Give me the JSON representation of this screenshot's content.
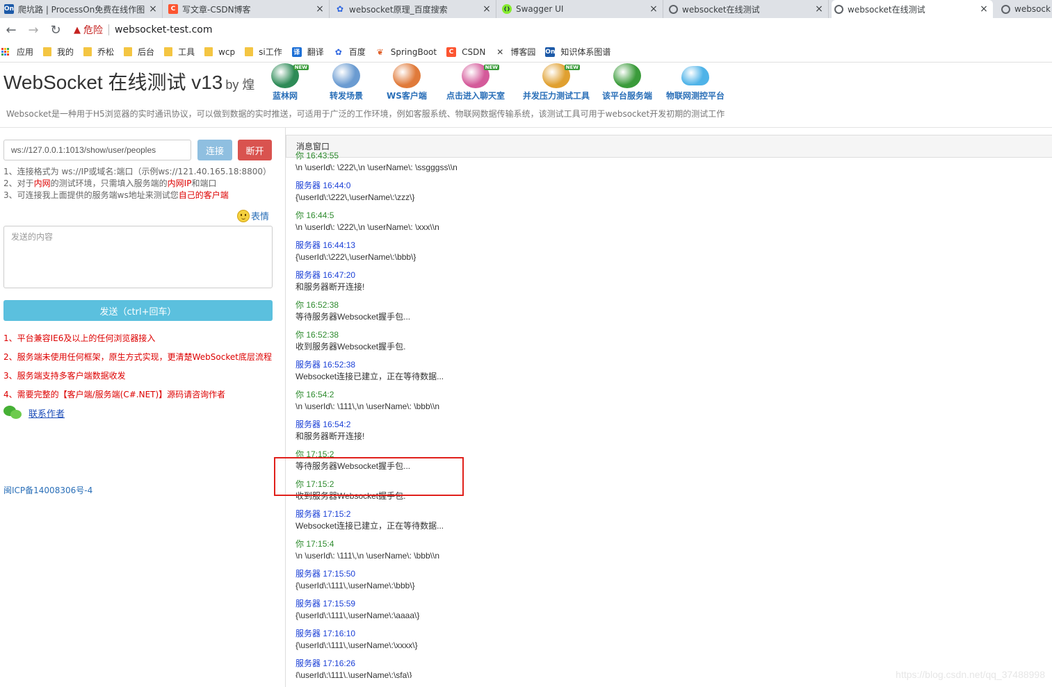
{
  "browser": {
    "tabs": [
      {
        "title": "爬坑路 | ProcessOn免费在线作图",
        "favicon": "On",
        "color": "#1d5aa8"
      },
      {
        "title": "写文章-CSDN博客",
        "favicon": "C",
        "color": "#fc5531"
      },
      {
        "title": "websocket原理_百度搜索",
        "favicon": "paw",
        "color": "#2d65e0"
      },
      {
        "title": "Swagger UI",
        "favicon": "S",
        "color": "#85ea2d"
      },
      {
        "title": "websocket在线测试",
        "favicon": "globe",
        "color": "#5f6368"
      },
      {
        "title": "websocket在线测试",
        "favicon": "globe",
        "color": "#5f6368"
      },
      {
        "title": "websock",
        "favicon": "globe",
        "color": "#5f6368"
      }
    ],
    "address": {
      "security": "危险",
      "url": "websocket-test.com"
    },
    "bookmarks": [
      {
        "label": "应用",
        "icon": "apps"
      },
      {
        "label": "我的",
        "icon": "folder"
      },
      {
        "label": "乔松",
        "icon": "folder"
      },
      {
        "label": "后台",
        "icon": "folder"
      },
      {
        "label": "工具",
        "icon": "folder"
      },
      {
        "label": "wcp",
        "icon": "folder"
      },
      {
        "label": "si工作",
        "icon": "folder"
      },
      {
        "label": "翻译",
        "icon": "translate"
      },
      {
        "label": "百度",
        "icon": "baidu"
      },
      {
        "label": "SpringBoot",
        "icon": "spring"
      },
      {
        "label": "CSDN",
        "icon": "csdn"
      },
      {
        "label": "博客园",
        "icon": "cnblogs"
      },
      {
        "label": "知识体系图谱",
        "icon": "processon"
      }
    ]
  },
  "header": {
    "title": "WebSocket 在线测试 v13",
    "by": "by 煌",
    "tools": [
      {
        "label": "蓝林网",
        "new": true,
        "color": "#2e8b57"
      },
      {
        "label": "转发场景",
        "new": false,
        "color": "#6a9bd1"
      },
      {
        "label": "WS客户端",
        "new": false,
        "color": "#e07a3a"
      },
      {
        "label": "点击进入聊天室",
        "new": true,
        "color": "#d45a9a"
      },
      {
        "label": "并发压力测试工具",
        "new": true,
        "color": "#e0a030"
      },
      {
        "label": "该平台服务端",
        "new": false,
        "color": "#3a9b3a"
      },
      {
        "label": "物联网测控平台",
        "new": false,
        "color": "#4fb3e8"
      }
    ],
    "description": "Websocket是一种用于H5浏览器的实时通讯协议，可以做到数据的实时推送，可适用于广泛的工作环境，例如客服系统、物联网数据传输系统，该测试工具可用于websocket开发初期的测试工作"
  },
  "left": {
    "ws_url": "ws://127.0.0.1:1013/show/user/peoples",
    "connect_label": "连接",
    "disconnect_label": "断开",
    "tips": {
      "line1": "1、连接格式为 ws://IP或域名:端口（示例ws://121.40.165.18:8800）",
      "line2_a": "2、对于",
      "line2_b": "内网",
      "line2_c": "的测试环境，只需填入服务端的",
      "line2_d": "内网IP",
      "line2_e": "和端口",
      "line3_a": "3、可连接我上面提供的服务端ws地址来测试您",
      "line3_b": "自己的客户端"
    },
    "emoji_label": "表情",
    "send_placeholder": "发送的内容",
    "send_label": "发送（ctrl+回车）",
    "features": [
      "1、平台兼容IE6及以上的任何浏览器接入",
      "2、服务端未使用任何框架，原生方式实现，更清楚WebSocket底层流程",
      "3、服务端支持多客户端数据收发",
      "4、需要完整的【客户端/服务端(C#.NET)】源码请咨询作者"
    ],
    "contact_label": "联系作者",
    "icp": "闽ICP备14008306号-4"
  },
  "messages_panel": {
    "title": "消息窗口",
    "messages": [
      {
        "who": "你 16:43:55",
        "type": "you",
        "body": "\\n \\userId\\: \\222\\,\\n \\userName\\: \\ssgggss\\\\n"
      },
      {
        "who": "服务器 16:44:0",
        "type": "server",
        "body": "{\\userId\\:\\222\\,\\userName\\:\\zzz\\}"
      },
      {
        "who": "你 16:44:5",
        "type": "you",
        "body": "\\n \\userId\\: \\222\\,\\n \\userName\\: \\xxx\\\\n"
      },
      {
        "who": "服务器 16:44:13",
        "type": "server",
        "body": "{\\userId\\:\\222\\,\\userName\\:\\bbb\\}"
      },
      {
        "who": "服务器 16:47:20",
        "type": "server",
        "body": "和服务器断开连接!"
      },
      {
        "who": "你 16:52:38",
        "type": "you",
        "body": "等待服务器Websocket握手包..."
      },
      {
        "who": "你 16:52:38",
        "type": "you",
        "body": "收到服务器Websocket握手包."
      },
      {
        "who": "服务器 16:52:38",
        "type": "server",
        "body": "Websocket连接已建立，正在等待数据..."
      },
      {
        "who": "你 16:54:2",
        "type": "you",
        "body": "\\n \\userId\\: \\111\\,\\n \\userName\\: \\bbb\\\\n"
      },
      {
        "who": "服务器 16:54:2",
        "type": "server",
        "body": "和服务器断开连接!"
      },
      {
        "who": "你 17:15:2",
        "type": "you",
        "body": "等待服务器Websocket握手包..."
      },
      {
        "who": "你 17:15:2",
        "type": "you",
        "body": "收到服务器Websocket握手包."
      },
      {
        "who": "服务器 17:15:2",
        "type": "server",
        "body": "Websocket连接已建立，正在等待数据..."
      },
      {
        "who": "你 17:15:4",
        "type": "you",
        "body": "\\n \\userId\\: \\111\\,\\n \\userName\\: \\bbb\\\\n"
      },
      {
        "who": "服务器 17:15:50",
        "type": "server",
        "body": "{\\userId\\:\\111\\,\\userName\\:\\bbb\\}"
      },
      {
        "who": "服务器 17:15:59",
        "type": "server",
        "body": "{\\userId\\:\\111\\,\\userName\\:\\aaaa\\}"
      },
      {
        "who": "服务器 17:16:10",
        "type": "server",
        "body": "{\\userId\\:\\111\\,\\userName\\:\\xxxx\\}"
      },
      {
        "who": "服务器 17:16:26",
        "type": "server",
        "body": "{\\userId\\:\\111\\,\\userName\\:\\sfa\\}"
      }
    ],
    "highlight_color": "#e0201b"
  },
  "watermark": "https://blog.csdn.net/qq_37488998"
}
